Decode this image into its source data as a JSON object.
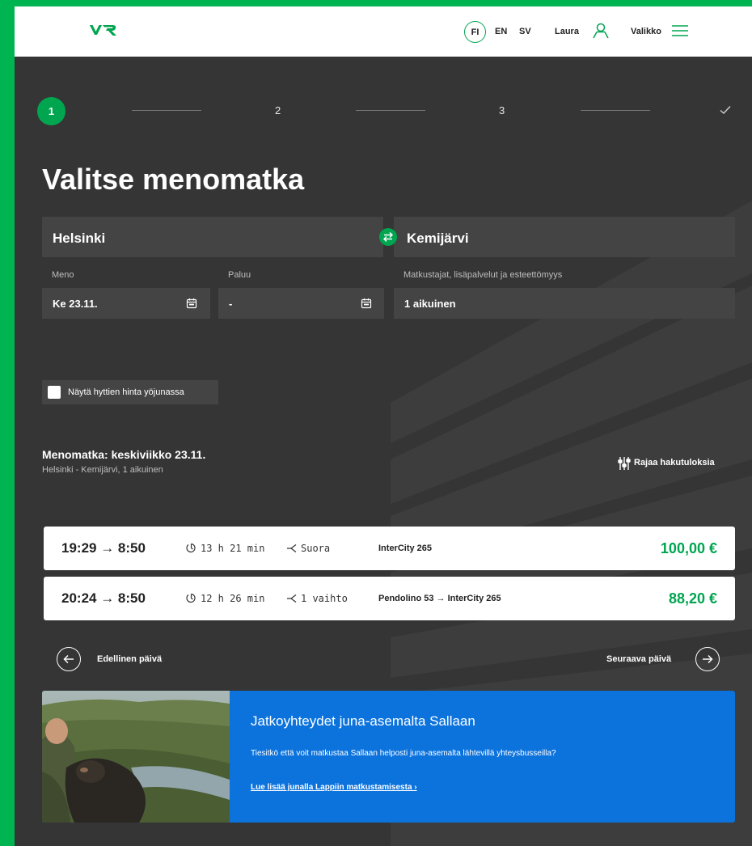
{
  "header": {
    "brand": "VR",
    "lang_fi": "FI",
    "lang_en": "EN",
    "lang_sv": "SV",
    "user": "Laura",
    "menu": "Valikko",
    "icons": [
      "vr-logo-icon",
      "user-icon",
      "hamburger-menu-icon"
    ]
  },
  "steps": {
    "items": [
      "1",
      "2",
      "3"
    ],
    "active": "1",
    "final_icon": "checkmark-icon"
  },
  "page": {
    "title": "Valitse menomatka"
  },
  "search": {
    "from": "Helsinki",
    "to": "Kemijärvi",
    "swap_icon": "swap-arrows-icon",
    "depart_label": "Meno",
    "depart_value": "Ke 23.11.",
    "return_label": "Paluu",
    "return_value": "-",
    "passengers_label": "Matkustajat, lisäpalvelut ja esteettömyys",
    "passengers_value": "1 aikuinen"
  },
  "options": {
    "cabin_price_label": "Näytä hyttien hinta yöjunassa",
    "cabin_price_checked": false
  },
  "results": {
    "title": "Menomatka: keskiviikko 23.11.",
    "subtitle": "Helsinki - Kemijärvi, 1 aikuinen",
    "filter_label": "Rajaa hakutuloksia",
    "trips": [
      {
        "times": "19:29 → 8:50",
        "duration": "13 h 21 min",
        "changes": "Suora",
        "train": "InterCity 265",
        "price": "100,00 €"
      },
      {
        "times": "20:24 → 8:50",
        "duration": "12 h 26 min",
        "changes": "1 vaihto",
        "train": "Pendolino 53 → InterCity 265",
        "price": "88,20 €"
      }
    ],
    "prev_day": "Edellinen päivä",
    "next_day": "Seuraava päivä"
  },
  "promo": {
    "title": "Jatkoyhteydet juna-asemalta Sallaan",
    "text": "Tiesitkö että voit matkustaa Sallaan helposti juna-asemalta lähtevillä yhteysbusseilla?",
    "link": "Lue lisää junalla Lappiin matkustamisesta ›"
  },
  "colors": {
    "brand_green": "#00a550",
    "background": "#353535",
    "field": "#444444",
    "promo_blue": "#0c73dd"
  }
}
